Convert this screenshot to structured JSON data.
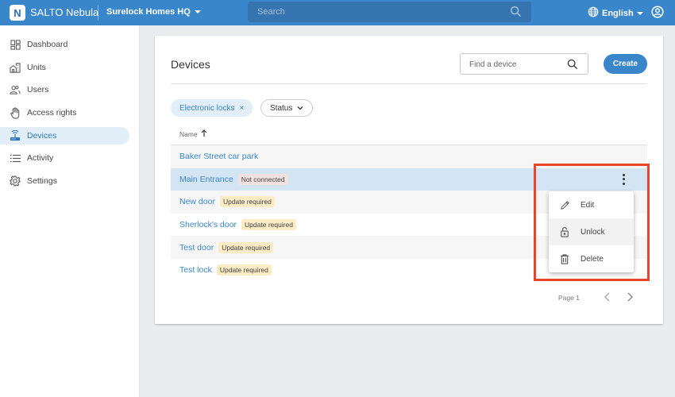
{
  "topbar": {
    "logo_letter": "N",
    "brand": "SALTO Nebula",
    "site": "Surelock Homes HQ",
    "search_placeholder": "Search",
    "language": "English",
    "icons": [
      "logo-icon",
      "chevron-down-icon",
      "search-icon",
      "globe-icon",
      "account-circle-icon"
    ]
  },
  "sidebar": {
    "items": [
      {
        "label": "Dashboard",
        "icon": "dashboard-icon",
        "active": false
      },
      {
        "label": "Units",
        "icon": "units-icon",
        "active": false
      },
      {
        "label": "Users",
        "icon": "users-icon",
        "active": false
      },
      {
        "label": "Access rights",
        "icon": "hand-icon",
        "active": false
      },
      {
        "label": "Devices",
        "icon": "router-icon",
        "active": true
      },
      {
        "label": "Activity",
        "icon": "list-icon",
        "active": false
      },
      {
        "label": "Settings",
        "icon": "gear-icon",
        "active": false
      }
    ]
  },
  "main": {
    "title": "Devices",
    "find_placeholder": "Find a device",
    "create_label": "Create",
    "filters": {
      "active_chip": "Electronic locks",
      "status_label": "Status"
    },
    "column_header": "Name",
    "rows": [
      {
        "name": "Baker Street car park",
        "badge": null,
        "badge_type": null
      },
      {
        "name": "Main Entrance",
        "badge": "Not connected",
        "badge_type": "error"
      },
      {
        "name": "New door",
        "badge": "Update required",
        "badge_type": "warning"
      },
      {
        "name": "Sherlock's door",
        "badge": "Update required",
        "badge_type": "warning"
      },
      {
        "name": "Test door",
        "badge": "Update required",
        "badge_type": "warning"
      },
      {
        "name": "Test lock",
        "badge": "Update required",
        "badge_type": "warning"
      }
    ],
    "pagination": {
      "label": "Page 1"
    }
  },
  "context_menu": {
    "items": [
      {
        "label": "Edit",
        "icon": "pencil-icon"
      },
      {
        "label": "Unlock",
        "icon": "lock-open-icon"
      },
      {
        "label": "Delete",
        "icon": "trash-icon"
      }
    ]
  },
  "colors": {
    "primary": "#3a86cb",
    "highlight_box": "#e8452c",
    "selected_row": "#d3e5f3",
    "warning_badge": "#fbecc6",
    "error_badge": "#f3e1e1"
  }
}
